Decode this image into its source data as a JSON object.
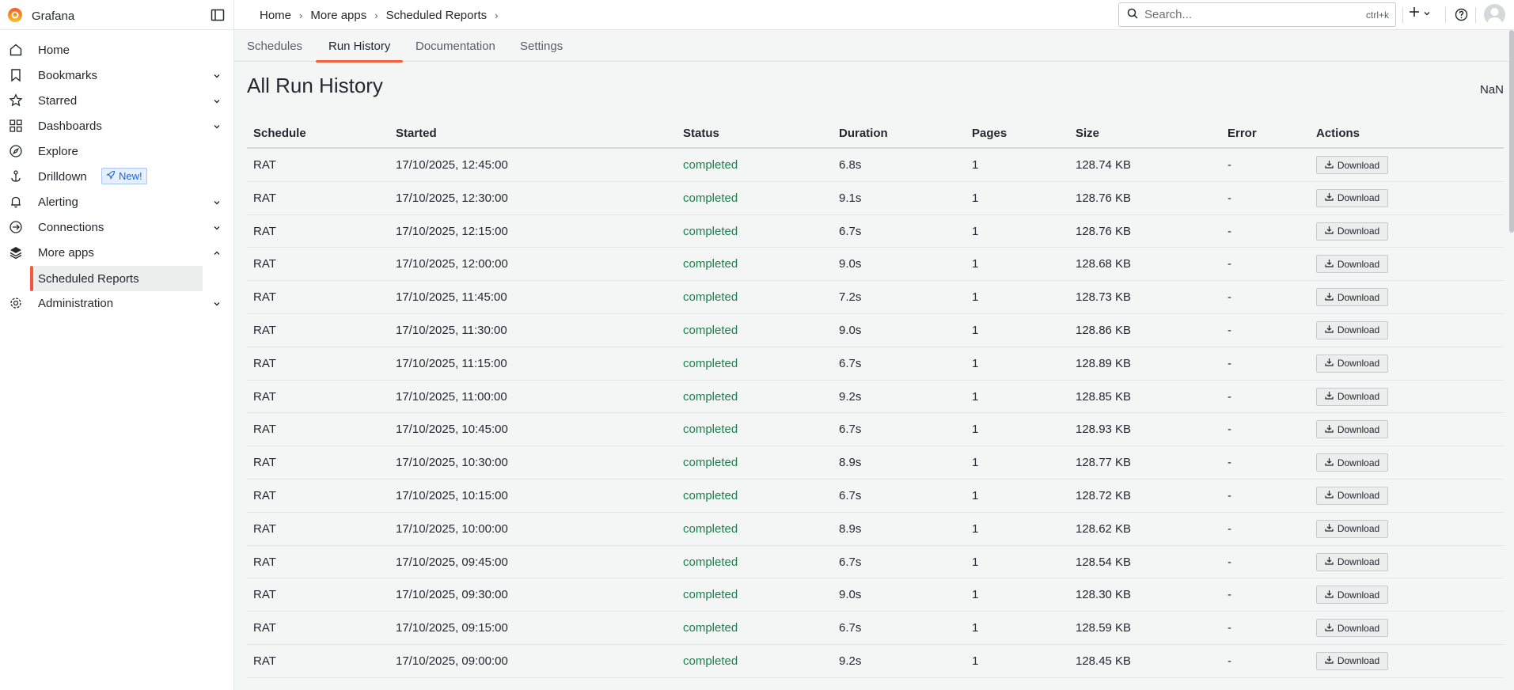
{
  "app": {
    "name": "Grafana"
  },
  "breadcrumb": [
    "Home",
    "More apps",
    "Scheduled Reports"
  ],
  "search": {
    "placeholder": "Search...",
    "shortcut": "ctrl+k"
  },
  "sidebar": {
    "items": [
      {
        "label": "Home",
        "icon": "home-icon",
        "chevron": false
      },
      {
        "label": "Bookmarks",
        "icon": "bookmark-icon",
        "chevron": true
      },
      {
        "label": "Starred",
        "icon": "star-icon",
        "chevron": true
      },
      {
        "label": "Dashboards",
        "icon": "apps-icon",
        "chevron": true
      },
      {
        "label": "Explore",
        "icon": "compass-icon",
        "chevron": false
      },
      {
        "label": "Drilldown",
        "icon": "drilldown-icon",
        "chevron": false,
        "badge": "New!"
      },
      {
        "label": "Alerting",
        "icon": "bell-icon",
        "chevron": true
      },
      {
        "label": "Connections",
        "icon": "link-icon",
        "chevron": true
      },
      {
        "label": "More apps",
        "icon": "layers-icon",
        "chevron": true,
        "expanded": true
      },
      {
        "label": "Administration",
        "icon": "cog-icon",
        "chevron": true
      }
    ],
    "sub_items": [
      {
        "label": "Scheduled Reports",
        "active": true
      }
    ]
  },
  "tabs": [
    {
      "label": "Schedules",
      "active": false
    },
    {
      "label": "Run History",
      "active": true
    },
    {
      "label": "Documentation",
      "active": false
    },
    {
      "label": "Settings",
      "active": false
    }
  ],
  "page": {
    "title": "All Run History",
    "corner_value": "NaN"
  },
  "table": {
    "columns": [
      "Schedule",
      "Started",
      "Status",
      "Duration",
      "Pages",
      "Size",
      "Error",
      "Actions"
    ],
    "download_label": "Download",
    "rows": [
      [
        "RAT",
        "17/10/2025, 12:45:00",
        "completed",
        "6.8s",
        "1",
        "128.74 KB",
        "-"
      ],
      [
        "RAT",
        "17/10/2025, 12:30:00",
        "completed",
        "9.1s",
        "1",
        "128.76 KB",
        "-"
      ],
      [
        "RAT",
        "17/10/2025, 12:15:00",
        "completed",
        "6.7s",
        "1",
        "128.76 KB",
        "-"
      ],
      [
        "RAT",
        "17/10/2025, 12:00:00",
        "completed",
        "9.0s",
        "1",
        "128.68 KB",
        "-"
      ],
      [
        "RAT",
        "17/10/2025, 11:45:00",
        "completed",
        "7.2s",
        "1",
        "128.73 KB",
        "-"
      ],
      [
        "RAT",
        "17/10/2025, 11:30:00",
        "completed",
        "9.0s",
        "1",
        "128.86 KB",
        "-"
      ],
      [
        "RAT",
        "17/10/2025, 11:15:00",
        "completed",
        "6.7s",
        "1",
        "128.89 KB",
        "-"
      ],
      [
        "RAT",
        "17/10/2025, 11:00:00",
        "completed",
        "9.2s",
        "1",
        "128.85 KB",
        "-"
      ],
      [
        "RAT",
        "17/10/2025, 10:45:00",
        "completed",
        "6.7s",
        "1",
        "128.93 KB",
        "-"
      ],
      [
        "RAT",
        "17/10/2025, 10:30:00",
        "completed",
        "8.9s",
        "1",
        "128.77 KB",
        "-"
      ],
      [
        "RAT",
        "17/10/2025, 10:15:00",
        "completed",
        "6.7s",
        "1",
        "128.72 KB",
        "-"
      ],
      [
        "RAT",
        "17/10/2025, 10:00:00",
        "completed",
        "8.9s",
        "1",
        "128.62 KB",
        "-"
      ],
      [
        "RAT",
        "17/10/2025, 09:45:00",
        "completed",
        "6.7s",
        "1",
        "128.54 KB",
        "-"
      ],
      [
        "RAT",
        "17/10/2025, 09:30:00",
        "completed",
        "9.0s",
        "1",
        "128.30 KB",
        "-"
      ],
      [
        "RAT",
        "17/10/2025, 09:15:00",
        "completed",
        "6.7s",
        "1",
        "128.59 KB",
        "-"
      ],
      [
        "RAT",
        "17/10/2025, 09:00:00",
        "completed",
        "9.2s",
        "1",
        "128.45 KB",
        "-"
      ]
    ]
  },
  "colors": {
    "accent": "#f55f3e",
    "status_completed": "#1a7f4b",
    "badge_blue": "#1f62e0"
  }
}
